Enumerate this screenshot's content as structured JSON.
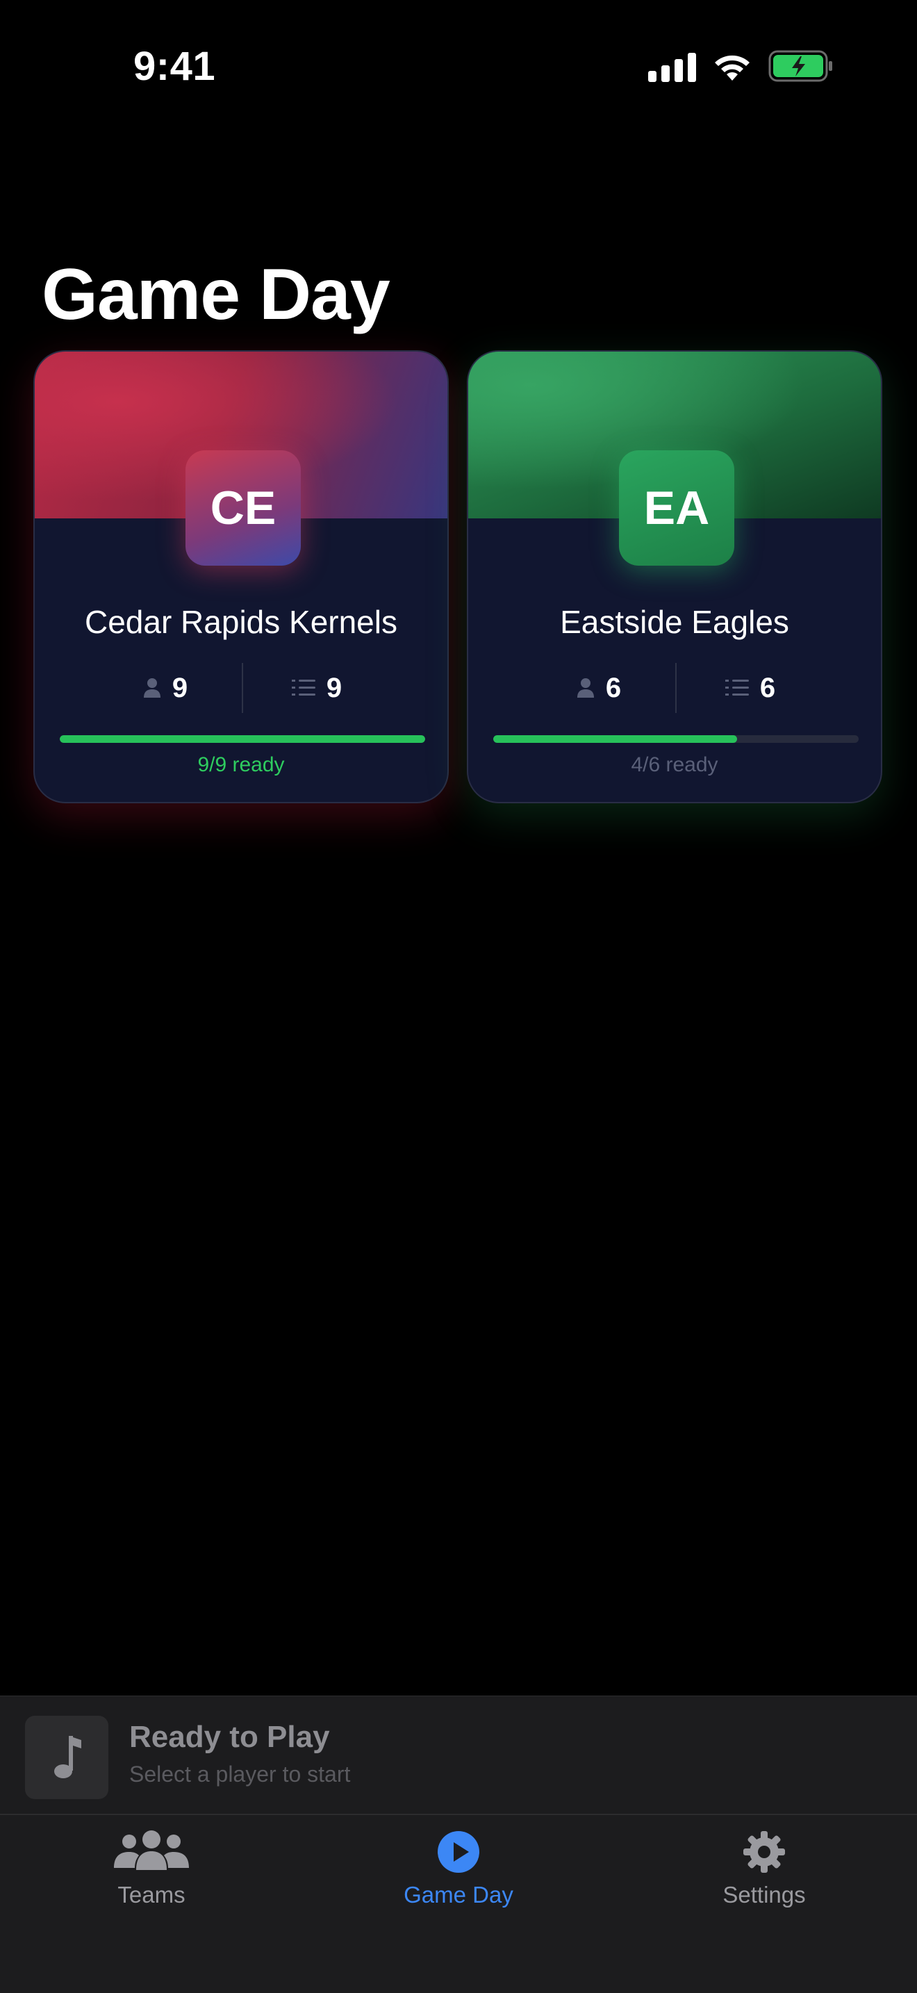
{
  "status_bar": {
    "time": "9:41",
    "battery_color": "#2ecc5f"
  },
  "page": {
    "title": "Game Day"
  },
  "teams": [
    {
      "initials": "CE",
      "name": "Cedar Rapids Kernels",
      "players": "9",
      "lineup": "9",
      "ready_text": "9/9 ready",
      "ready_fraction": 1.0,
      "accent": "#c6304d"
    },
    {
      "initials": "EA",
      "name": "Eastside Eagles",
      "players": "6",
      "lineup": "6",
      "ready_text": "4/6 ready",
      "ready_fraction": 0.6667,
      "accent": "#2aa55e"
    }
  ],
  "mini_player": {
    "title": "Ready to Play",
    "subtitle": "Select a player to start",
    "icon": "music-note-icon"
  },
  "tab_bar": {
    "tabs": [
      {
        "label": "Teams",
        "icon": "people-icon",
        "active": false
      },
      {
        "label": "Game Day",
        "icon": "play-circle-icon",
        "active": true
      },
      {
        "label": "Settings",
        "icon": "gear-icon",
        "active": false
      }
    ],
    "active_color": "#3c87f5"
  }
}
